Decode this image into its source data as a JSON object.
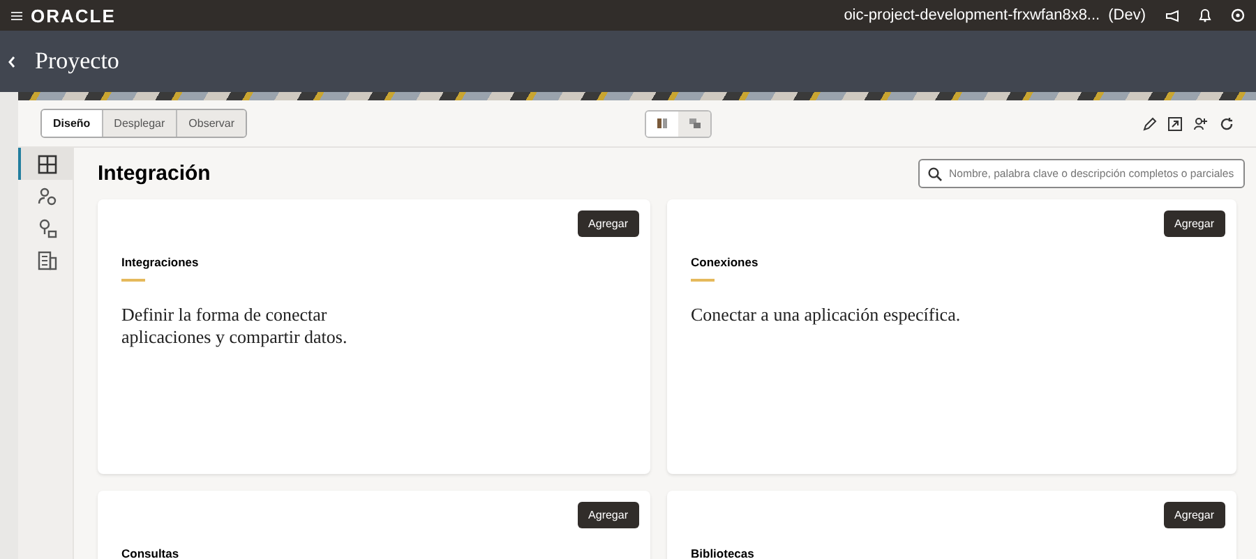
{
  "header": {
    "brand": "ORACLE",
    "instance": "oic-project-development-frxwfan8x8...",
    "env": "(Dev)"
  },
  "page": {
    "title": "Proyecto"
  },
  "tabs": [
    {
      "label": "Diseño",
      "selected": true
    },
    {
      "label": "Desplegar",
      "selected": false
    },
    {
      "label": "Observar",
      "selected": false
    }
  ],
  "view_toggle": [
    {
      "kind": "grid",
      "selected": true
    },
    {
      "kind": "list",
      "selected": false
    }
  ],
  "sidebar": {
    "items": [
      {
        "kind": "integration",
        "selected": true
      },
      {
        "kind": "people",
        "selected": false
      },
      {
        "kind": "connection",
        "selected": false
      },
      {
        "kind": "library",
        "selected": false
      }
    ]
  },
  "content": {
    "heading": "Integración",
    "search": {
      "placeholder": "Nombre, palabra clave o descripción completos o parciales"
    },
    "cards": [
      {
        "title": "Integraciones",
        "description": "Definir la forma de conectar aplicaciones y compartir datos.",
        "button": "Agregar"
      },
      {
        "title": "Conexiones",
        "description": "Conectar a una aplicación específica.",
        "button": "Agregar"
      },
      {
        "title": "Consultas",
        "button": "Agregar"
      },
      {
        "title": "Bibliotecas",
        "button": "Agregar"
      }
    ]
  }
}
